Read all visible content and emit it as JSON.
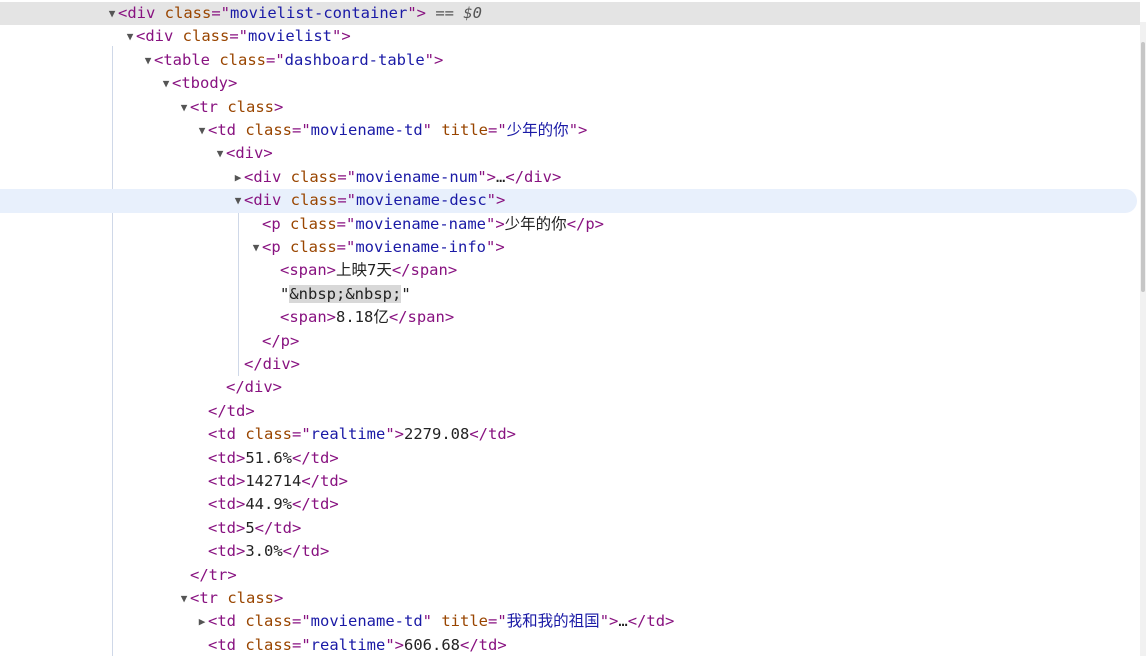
{
  "domain_panel": "elements",
  "console_ref": "$0",
  "nodes": [
    {
      "id": "n0",
      "indent": 0,
      "toggle": "expanded",
      "selected": true,
      "parts": [
        [
          "tag",
          "<div "
        ],
        [
          "an",
          "class"
        ],
        [
          "tag",
          "=\""
        ],
        [
          "av",
          "movielist-container"
        ],
        [
          "tag",
          "\">"
        ],
        [
          "dim",
          " == "
        ],
        [
          "dollar",
          "$0"
        ]
      ]
    },
    {
      "id": "n1",
      "indent": 1,
      "toggle": "expanded",
      "parts": [
        [
          "tag",
          "<div "
        ],
        [
          "an",
          "class"
        ],
        [
          "tag",
          "=\""
        ],
        [
          "av",
          "movielist"
        ],
        [
          "tag",
          "\">"
        ]
      ]
    },
    {
      "id": "n2",
      "indent": 2,
      "toggle": "expanded",
      "parts": [
        [
          "tag",
          "<table "
        ],
        [
          "an",
          "class"
        ],
        [
          "tag",
          "=\""
        ],
        [
          "av",
          "dashboard-table"
        ],
        [
          "tag",
          "\">"
        ]
      ]
    },
    {
      "id": "n3",
      "indent": 3,
      "toggle": "expanded",
      "parts": [
        [
          "tag",
          "<tbody>"
        ]
      ]
    },
    {
      "id": "n4",
      "indent": 4,
      "toggle": "expanded",
      "parts": [
        [
          "tag",
          "<tr "
        ],
        [
          "an",
          "class"
        ],
        [
          "tag",
          ">"
        ]
      ]
    },
    {
      "id": "n5",
      "indent": 5,
      "toggle": "expanded",
      "parts": [
        [
          "tag",
          "<td "
        ],
        [
          "an",
          "class"
        ],
        [
          "tag",
          "=\""
        ],
        [
          "av",
          "moviename-td"
        ],
        [
          "tag",
          "\" "
        ],
        [
          "an",
          "title"
        ],
        [
          "tag",
          "=\""
        ],
        [
          "av",
          "少年的你"
        ],
        [
          "tag",
          "\">"
        ]
      ]
    },
    {
      "id": "n6",
      "indent": 6,
      "toggle": "expanded",
      "parts": [
        [
          "tag",
          "<div>"
        ]
      ]
    },
    {
      "id": "n7",
      "indent": 7,
      "toggle": "collapsed",
      "parts": [
        [
          "tag",
          "<div "
        ],
        [
          "an",
          "class"
        ],
        [
          "tag",
          "=\""
        ],
        [
          "av",
          "moviename-num"
        ],
        [
          "tag",
          "\">"
        ],
        [
          "tx",
          "…"
        ],
        [
          "tag",
          "</div>"
        ]
      ]
    },
    {
      "id": "n8",
      "indent": 7,
      "toggle": "expanded",
      "hovered": true,
      "parts": [
        [
          "tag",
          "<div "
        ],
        [
          "an",
          "class"
        ],
        [
          "tag",
          "=\""
        ],
        [
          "av",
          "moviename-desc"
        ],
        [
          "tag",
          "\">"
        ]
      ]
    },
    {
      "id": "n9",
      "indent": 8,
      "toggle": "none",
      "parts": [
        [
          "tag",
          "<p "
        ],
        [
          "an",
          "class"
        ],
        [
          "tag",
          "=\""
        ],
        [
          "av",
          "moviename-name"
        ],
        [
          "tag",
          "\">"
        ],
        [
          "tx",
          "少年的你"
        ],
        [
          "tag",
          "</p>"
        ]
      ]
    },
    {
      "id": "n10",
      "indent": 8,
      "toggle": "expanded",
      "parts": [
        [
          "tag",
          "<p "
        ],
        [
          "an",
          "class"
        ],
        [
          "tag",
          "=\""
        ],
        [
          "av",
          "moviename-info"
        ],
        [
          "tag",
          "\">"
        ]
      ]
    },
    {
      "id": "n11",
      "indent": 9,
      "toggle": "none",
      "parts": [
        [
          "tag",
          "<span>"
        ],
        [
          "tx",
          "上映7天"
        ],
        [
          "tag",
          "</span>"
        ]
      ]
    },
    {
      "id": "n12",
      "indent": 9,
      "toggle": "none",
      "parts": [
        [
          "tx",
          "\""
        ],
        [
          "ent",
          "&nbsp;&nbsp;"
        ],
        [
          "tx",
          "\""
        ]
      ]
    },
    {
      "id": "n13",
      "indent": 9,
      "toggle": "none",
      "parts": [
        [
          "tag",
          "<span>"
        ],
        [
          "tx",
          "8.18亿"
        ],
        [
          "tag",
          "</span>"
        ]
      ]
    },
    {
      "id": "n14",
      "indent": 8,
      "toggle": "none",
      "parts": [
        [
          "tag",
          "</p>"
        ]
      ]
    },
    {
      "id": "n15",
      "indent": 7,
      "toggle": "none",
      "parts": [
        [
          "tag",
          "</div>"
        ]
      ]
    },
    {
      "id": "n16",
      "indent": 6,
      "toggle": "none",
      "parts": [
        [
          "tag",
          "</div>"
        ]
      ]
    },
    {
      "id": "n17",
      "indent": 5,
      "toggle": "none",
      "parts": [
        [
          "tag",
          "</td>"
        ]
      ]
    },
    {
      "id": "n18",
      "indent": 5,
      "toggle": "none",
      "parts": [
        [
          "tag",
          "<td "
        ],
        [
          "an",
          "class"
        ],
        [
          "tag",
          "=\""
        ],
        [
          "av",
          "realtime"
        ],
        [
          "tag",
          "\">"
        ],
        [
          "tx",
          "2279.08"
        ],
        [
          "tag",
          "</td>"
        ]
      ]
    },
    {
      "id": "n19",
      "indent": 5,
      "toggle": "none",
      "parts": [
        [
          "tag",
          "<td>"
        ],
        [
          "tx",
          "51.6%"
        ],
        [
          "tag",
          "</td>"
        ]
      ]
    },
    {
      "id": "n20",
      "indent": 5,
      "toggle": "none",
      "parts": [
        [
          "tag",
          "<td>"
        ],
        [
          "tx",
          "142714"
        ],
        [
          "tag",
          "</td>"
        ]
      ]
    },
    {
      "id": "n21",
      "indent": 5,
      "toggle": "none",
      "parts": [
        [
          "tag",
          "<td>"
        ],
        [
          "tx",
          "44.9%"
        ],
        [
          "tag",
          "</td>"
        ]
      ]
    },
    {
      "id": "n22",
      "indent": 5,
      "toggle": "none",
      "parts": [
        [
          "tag",
          "<td>"
        ],
        [
          "tx",
          "5"
        ],
        [
          "tag",
          "</td>"
        ]
      ]
    },
    {
      "id": "n23",
      "indent": 5,
      "toggle": "none",
      "parts": [
        [
          "tag",
          "<td>"
        ],
        [
          "tx",
          "3.0%"
        ],
        [
          "tag",
          "</td>"
        ]
      ]
    },
    {
      "id": "n24",
      "indent": 4,
      "toggle": "none",
      "parts": [
        [
          "tag",
          "</tr>"
        ]
      ]
    },
    {
      "id": "n25",
      "indent": 4,
      "toggle": "expanded",
      "parts": [
        [
          "tag",
          "<tr "
        ],
        [
          "an",
          "class"
        ],
        [
          "tag",
          ">"
        ]
      ]
    },
    {
      "id": "n26",
      "indent": 5,
      "toggle": "collapsed",
      "parts": [
        [
          "tag",
          "<td "
        ],
        [
          "an",
          "class"
        ],
        [
          "tag",
          "=\""
        ],
        [
          "av",
          "moviename-td"
        ],
        [
          "tag",
          "\" "
        ],
        [
          "an",
          "title"
        ],
        [
          "tag",
          "=\""
        ],
        [
          "av",
          "我和我的祖国"
        ],
        [
          "tag",
          "\">"
        ],
        [
          "tx",
          "…"
        ],
        [
          "tag",
          "</td>"
        ]
      ]
    },
    {
      "id": "n27",
      "indent": 5,
      "toggle": "none",
      "parts": [
        [
          "tag",
          "<td "
        ],
        [
          "an",
          "class"
        ],
        [
          "tag",
          "=\""
        ],
        [
          "av",
          "realtime"
        ],
        [
          "tag",
          "\">"
        ],
        [
          "tx",
          "606.68"
        ],
        [
          "tag",
          "</td>"
        ]
      ]
    }
  ]
}
